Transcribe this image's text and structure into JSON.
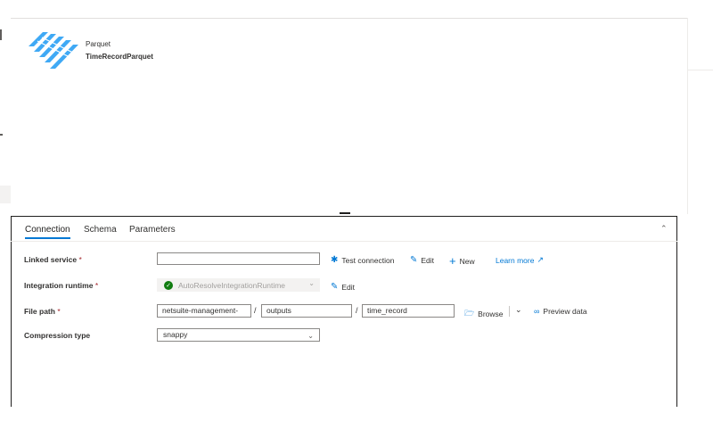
{
  "canvas": {
    "dataset_type": "Parquet",
    "dataset_name": "TimeRecordParquet"
  },
  "tabs": [
    {
      "label": "Connection",
      "active": true
    },
    {
      "label": "Schema",
      "active": false
    },
    {
      "label": "Parameters",
      "active": false
    }
  ],
  "connection": {
    "linked_service": {
      "label": "Linked service",
      "required_mark": "*",
      "value": "",
      "test_connection": "Test connection",
      "edit": "Edit",
      "new": "New",
      "learn_more": "Learn more"
    },
    "integration_runtime": {
      "label": "Integration runtime",
      "required_mark": "*",
      "value": "AutoResolveIntegrationRuntime",
      "edit": "Edit"
    },
    "file_path": {
      "label": "File path",
      "required_mark": "*",
      "container": "netsuite-management-",
      "directory": "outputs",
      "file": "time_record",
      "separator": "/",
      "browse": "Browse",
      "preview": "Preview data"
    },
    "compression": {
      "label": "Compression type",
      "value": "snappy"
    }
  },
  "colors": {
    "accent": "#0078d4",
    "success": "#107c10",
    "required": "#a4262c",
    "parquet_logo": "#3fa9f5"
  },
  "icons": [
    "parquet-logo",
    "test-connection-icon",
    "edit-icon",
    "add-icon",
    "external-link-icon",
    "checkmark-icon",
    "chevron-down-icon",
    "folder-icon",
    "glasses-icon",
    "chevron-up-icon"
  ]
}
